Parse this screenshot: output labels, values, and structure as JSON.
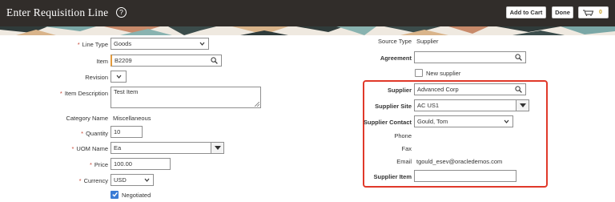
{
  "header": {
    "title": "Enter Requisition Line",
    "help_glyph": "?",
    "add_to_cart_label": "Add to Cart",
    "done_label": "Done",
    "cart_count": "0"
  },
  "left": {
    "line_type_label": "Line Type",
    "line_type_value": "Goods",
    "item_label": "Item",
    "item_value": "B2209",
    "revision_label": "Revision",
    "revision_value": "",
    "item_description_label": "Item Description",
    "item_description_value": "Test Item",
    "category_name_label": "Category Name",
    "category_name_value": "Miscellaneous",
    "quantity_label": "Quantity",
    "quantity_value": "10",
    "uom_name_label": "UOM Name",
    "uom_name_value": "Ea",
    "price_label": "Price",
    "price_value": "100.00",
    "currency_label": "Currency",
    "currency_value": "USD",
    "negotiated_label": "Negotiated",
    "negotiated_checked": true
  },
  "right": {
    "source_type_label": "Source Type",
    "source_type_value": "Supplier",
    "agreement_label": "Agreement",
    "agreement_value": "",
    "new_supplier_label": "New supplier",
    "new_supplier_checked": false,
    "supplier_label": "Supplier",
    "supplier_value": "Advanced Corp",
    "supplier_site_label": "Supplier Site",
    "supplier_site_value": "AC US1",
    "supplier_contact_label": "Supplier Contact",
    "supplier_contact_value": "Gould, Tom",
    "phone_label": "Phone",
    "phone_value": "",
    "fax_label": "Fax",
    "fax_value": "",
    "email_label": "Email",
    "email_value": "tgould_esev@oracledemos.com",
    "supplier_item_label": "Supplier Item",
    "supplier_item_value": ""
  },
  "icons": {
    "help": "help-icon",
    "cart": "cart-icon",
    "search": "search-icon",
    "dropdown": "chevron-down-icon"
  },
  "colors": {
    "header_bg": "#312d2a",
    "required_marker": "#c74634",
    "highlight_box": "#e0392a",
    "checkbox_checked": "#3a7bd5",
    "cart_count": "#c9a227"
  }
}
